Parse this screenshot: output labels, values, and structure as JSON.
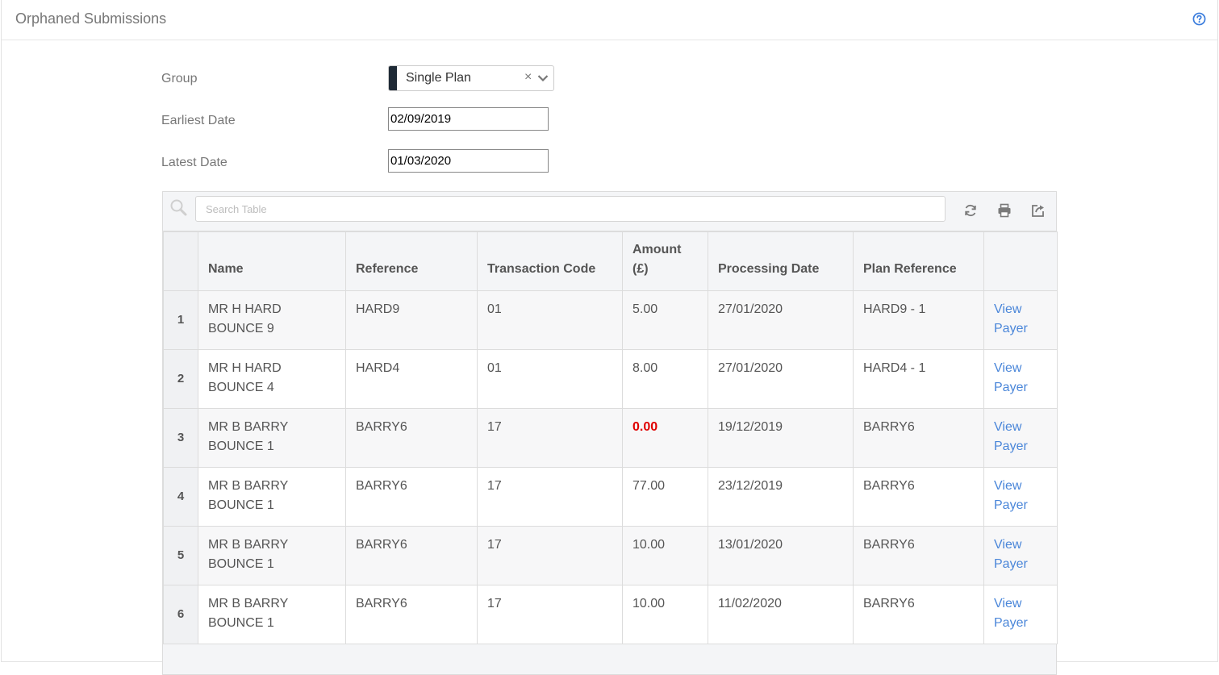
{
  "header": {
    "title": "Orphaned Submissions"
  },
  "form": {
    "group_label": "Group",
    "group_value": "Single Plan",
    "earliest_label": "Earliest Date",
    "earliest_value": "02/09/2019",
    "latest_label": "Latest Date",
    "latest_value": "01/03/2020"
  },
  "toolbar": {
    "search_placeholder": "Search Table"
  },
  "table": {
    "columns": {
      "name": "Name",
      "reference": "Reference",
      "transaction_code": "Transaction Code",
      "amount": "Amount (£)",
      "processing_date": "Processing Date",
      "plan_reference": "Plan Reference"
    },
    "rows": [
      {
        "index": "1",
        "name": "MR H HARD BOUNCE 9",
        "reference": "HARD9",
        "transaction_code": "01",
        "amount": "5.00",
        "processing_date": "27/01/2020",
        "plan_reference": "HARD9 - 1",
        "action": "View Payer"
      },
      {
        "index": "2",
        "name": "MR H HARD BOUNCE 4",
        "reference": "HARD4",
        "transaction_code": "01",
        "amount": "8.00",
        "processing_date": "27/01/2020",
        "plan_reference": "HARD4 - 1",
        "action": "View Payer"
      },
      {
        "index": "3",
        "name": "MR B BARRY BOUNCE 1",
        "reference": "BARRY6",
        "transaction_code": "17",
        "amount": "0.00",
        "processing_date": "19/12/2019",
        "plan_reference": "BARRY6",
        "action": "View Payer"
      },
      {
        "index": "4",
        "name": "MR B BARRY BOUNCE 1",
        "reference": "BARRY6",
        "transaction_code": "17",
        "amount": "77.00",
        "processing_date": "23/12/2019",
        "plan_reference": "BARRY6",
        "action": "View Payer"
      },
      {
        "index": "5",
        "name": "MR B BARRY BOUNCE 1",
        "reference": "BARRY6",
        "transaction_code": "17",
        "amount": "10.00",
        "processing_date": "13/01/2020",
        "plan_reference": "BARRY6",
        "action": "View Payer"
      },
      {
        "index": "6",
        "name": "MR B BARRY BOUNCE 1",
        "reference": "BARRY6",
        "transaction_code": "17",
        "amount": "10.00",
        "processing_date": "11/02/2020",
        "plan_reference": "BARRY6",
        "action": "View Payer"
      }
    ]
  },
  "colors": {
    "link": "#4a86d9",
    "zero_amount": "#e00000",
    "select_accent": "#1f2a36",
    "help_icon": "#3b7ddd"
  },
  "icons": {
    "help": "help-circle-icon",
    "search": "search-icon",
    "refresh": "refresh-icon",
    "print": "print-icon",
    "export": "export-icon",
    "clear": "clear-icon",
    "dropdown": "chevron-down-icon"
  }
}
